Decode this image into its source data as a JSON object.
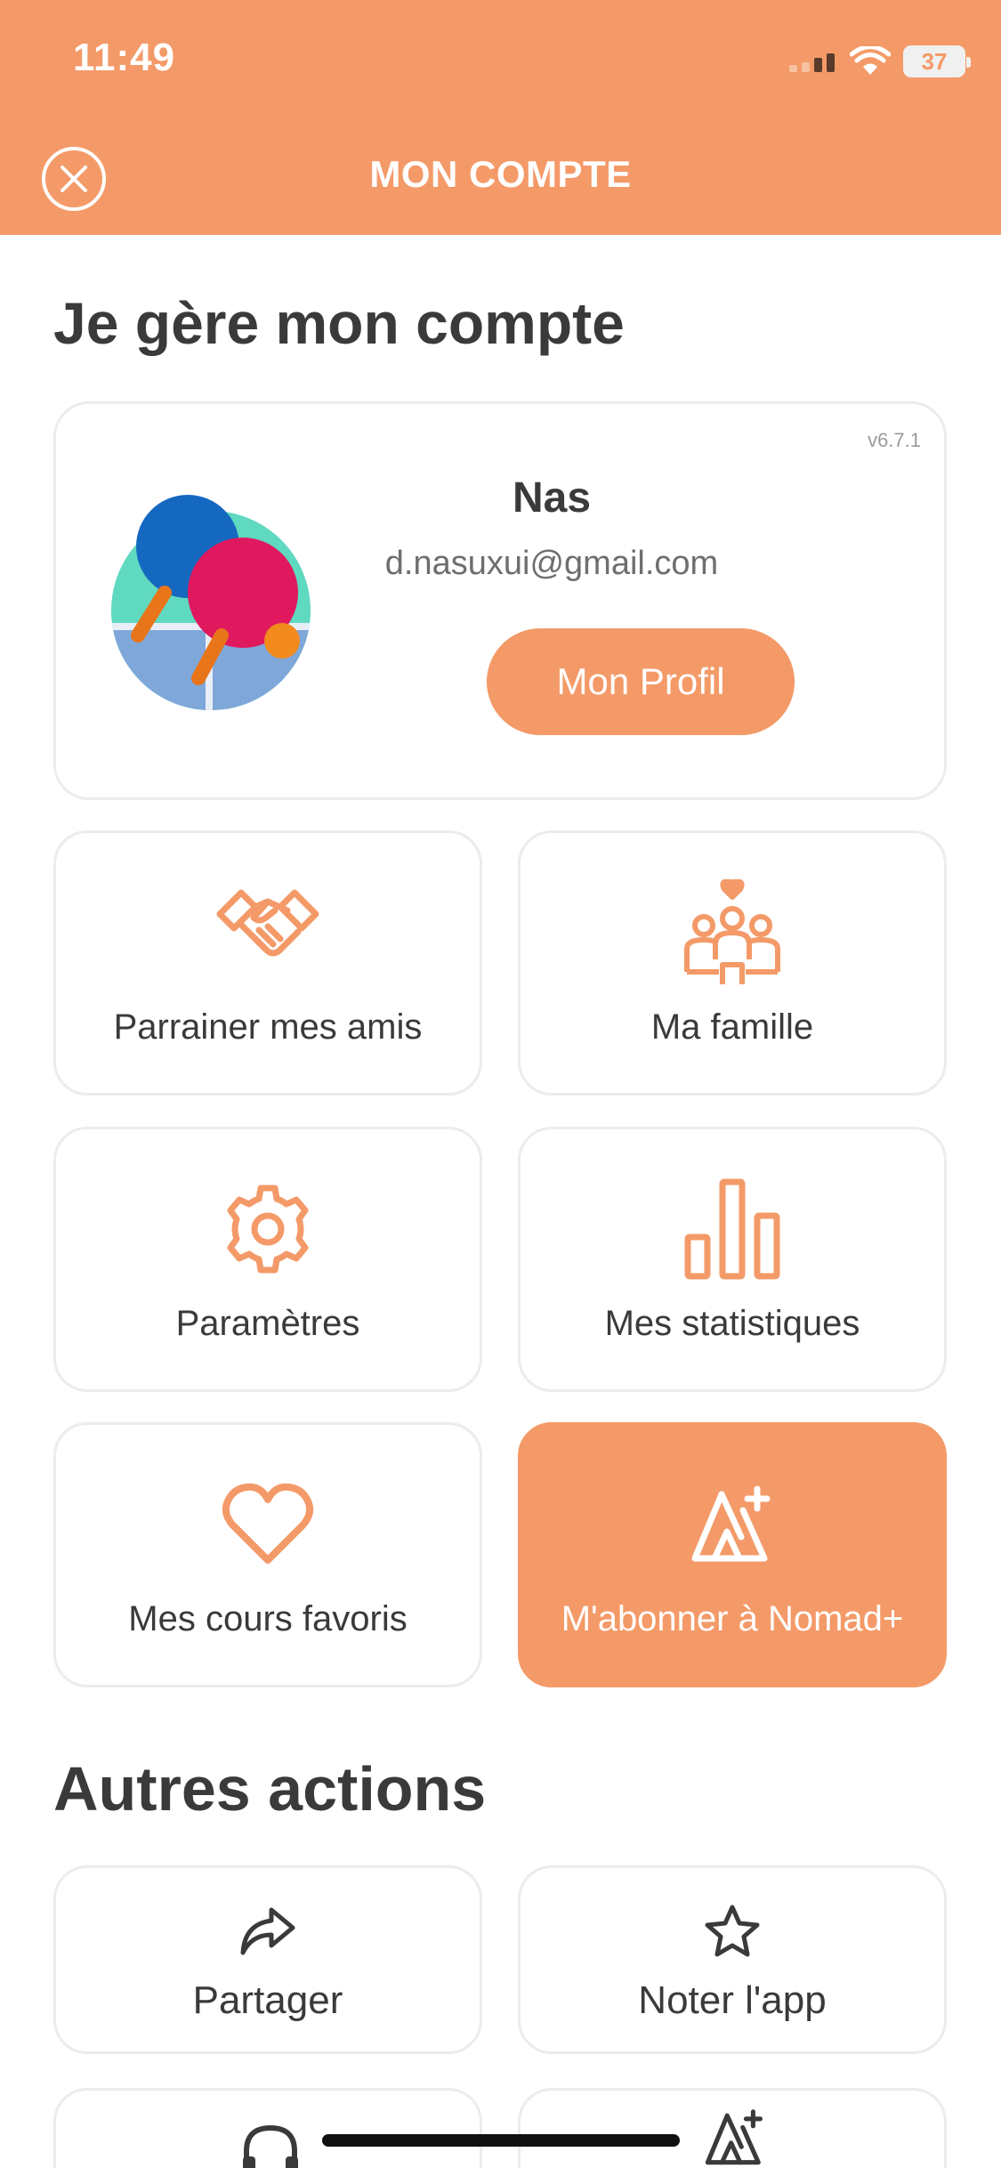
{
  "status_bar": {
    "time": "11:49",
    "battery": "37"
  },
  "header": {
    "title": "MON COMPTE"
  },
  "section_account": {
    "title": "Je gère mon compte"
  },
  "profile": {
    "version": "v6.7.1",
    "name": "Nas",
    "email": "d.nasuxui@gmail.com",
    "button_label": "Mon Profil"
  },
  "tiles": [
    {
      "label": "Parrainer mes amis",
      "icon": "handshake-icon"
    },
    {
      "label": "Ma famille",
      "icon": "family-icon"
    },
    {
      "label": "Paramètres",
      "icon": "gear-icon"
    },
    {
      "label": "Mes statistiques",
      "icon": "bar-chart-icon"
    },
    {
      "label": "Mes cours favoris",
      "icon": "heart-icon"
    },
    {
      "label": "M'abonner à Nomad+",
      "icon": "nomad-plus-icon"
    }
  ],
  "section_other": {
    "title": "Autres actions"
  },
  "other_actions": [
    {
      "label": "Partager",
      "icon": "share-icon"
    },
    {
      "label": "Noter l'app",
      "icon": "star-icon"
    },
    {
      "label": "",
      "icon": "headset-icon"
    },
    {
      "label": "",
      "icon": "nomad-plus-icon"
    }
  ],
  "colors": {
    "accent": "#f49a68",
    "text": "#3a3a3a",
    "border": "#ececec"
  }
}
